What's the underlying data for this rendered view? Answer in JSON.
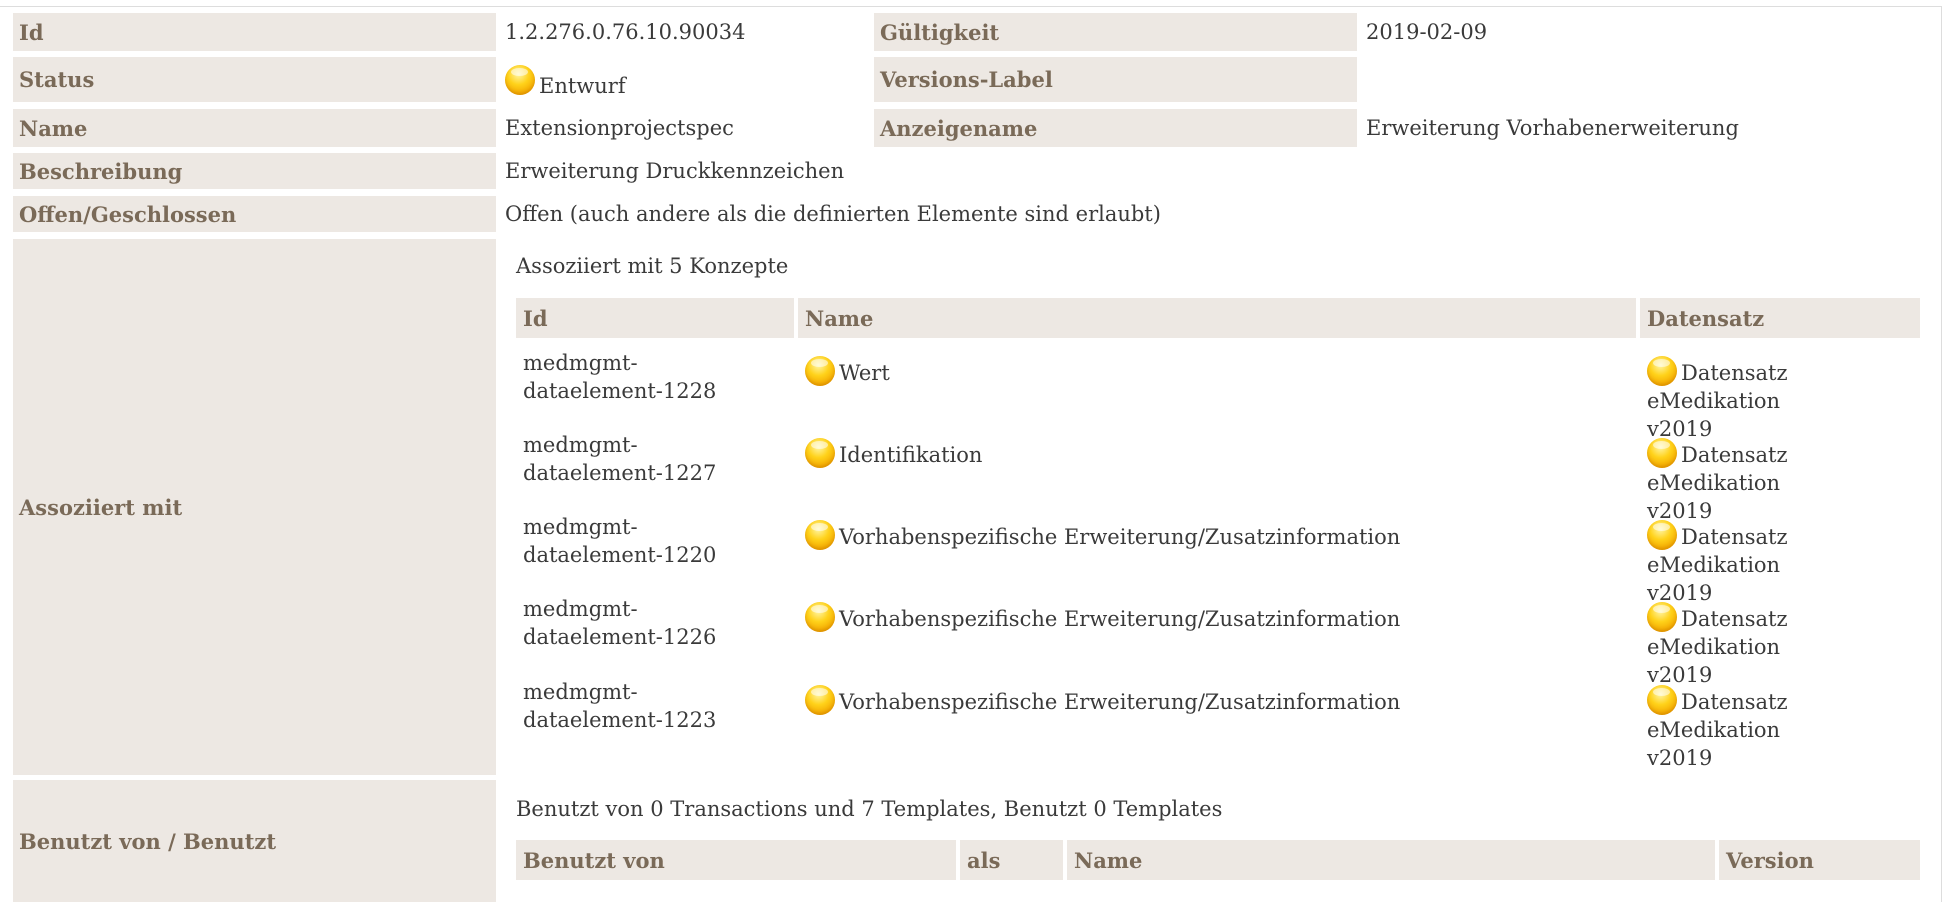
{
  "rows": {
    "id": {
      "label": "Id",
      "value": "1.2.276.0.76.10.90034",
      "label2": "Gültigkeit",
      "value2": "2019-02-09"
    },
    "status": {
      "label": "Status",
      "value": "Entwurf",
      "label2": "Versions-Label",
      "value2": ""
    },
    "name": {
      "label": "Name",
      "value": "Extensionprojectspec",
      "label2": "Anzeigename",
      "value2": "Erweiterung Vorhabenerweiterung"
    },
    "beschreibung": {
      "label": "Beschreibung",
      "value": "Erweiterung Druckkennzeichen"
    },
    "offen": {
      "label": "Offen/Geschlossen",
      "value": "Offen (auch andere als die definierten Elemente sind erlaubt)"
    },
    "assoziiert": {
      "label": "Assoziiert mit"
    },
    "benutzt": {
      "label": "Benutzt von / Benutzt"
    }
  },
  "assoc": {
    "caption": "Assoziiert mit 5 Konzepte",
    "headers": [
      "Id",
      "Name",
      "Datensatz"
    ],
    "items": [
      {
        "id_line1": "medmgmt-",
        "id_line2": "dataelement-1228",
        "name": "Wert",
        "set_line1": "Datensatz",
        "set_line2": "eMedikation v2019"
      },
      {
        "id_line1": "medmgmt-",
        "id_line2": "dataelement-1227",
        "name": "Identifikation",
        "set_line1": "Datensatz",
        "set_line2": "eMedikation v2019"
      },
      {
        "id_line1": "medmgmt-",
        "id_line2": "dataelement-1220",
        "name": "Vorhabenspezifische Erweiterung/Zusatzinformation",
        "set_line1": "Datensatz",
        "set_line2": "eMedikation v2019"
      },
      {
        "id_line1": "medmgmt-",
        "id_line2": "dataelement-1226",
        "name": "Vorhabenspezifische Erweiterung/Zusatzinformation",
        "set_line1": "Datensatz",
        "set_line2": "eMedikation v2019"
      },
      {
        "id_line1": "medmgmt-",
        "id_line2": "dataelement-1223",
        "name": "Vorhabenspezifische Erweiterung/Zusatzinformation",
        "set_line1": "Datensatz",
        "set_line2": "eMedikation v2019"
      }
    ]
  },
  "usage": {
    "caption": "Benutzt von 0 Transactions und 7 Templates, Benutzt 0 Templates",
    "headers": [
      "Benutzt von",
      "als",
      "Name",
      "Version"
    ]
  },
  "icons": {
    "status": "yellow-orb-icon"
  },
  "colors": {
    "label_bg": "#ede8e3",
    "label_text": "#7a6a58",
    "orb": "#ffd21a"
  }
}
